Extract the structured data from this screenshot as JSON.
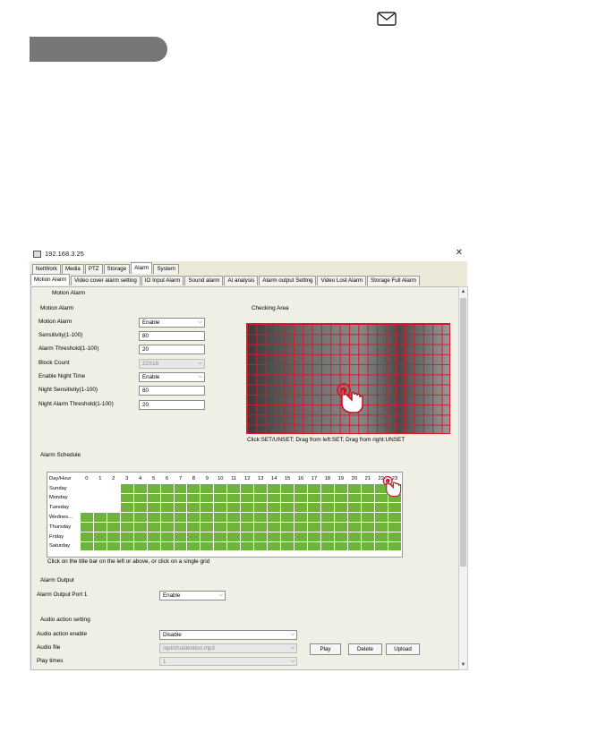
{
  "window": {
    "title": "192.168.3.25",
    "close_glyph": "✕"
  },
  "main_tabs": [
    "NetWork",
    "Media",
    "PTZ",
    "Storage",
    "Alarm",
    "System"
  ],
  "sub_tabs": [
    "Motion Alarm",
    "Video cover alarm setting",
    "IO Input Alarm",
    "Sound alarm",
    "AI analysis",
    "Alarm output Setting",
    "Video Lost Alarm",
    "Storage Full Alarm"
  ],
  "page": {
    "title": "Motion Alarm"
  },
  "motion": {
    "section": "Motion Alarm",
    "motion_alarm_label": "Motion Alarm",
    "motion_alarm_value": "Enable",
    "sensitivity_label": "Sensitivity(1-100)",
    "sensitivity_value": "80",
    "threshold_label": "Alarm Threshold(1-100)",
    "threshold_value": "20",
    "block_count_label": "Block Count",
    "block_count_value": "22X18",
    "night_time_label": "Enable Night Time",
    "night_time_value": "Enable",
    "night_sens_label": "Night Sensitivity(1-100)",
    "night_sens_value": "80",
    "night_threshold_label": "Night Alarm Threshold(1-100)",
    "night_threshold_value": "20"
  },
  "checking": {
    "title": "Checking Area",
    "hint": "Click:SET/UNSET; Drag from left:SET; Drag from right:UNSET"
  },
  "schedule": {
    "title": "Alarm Schedule",
    "header": "Day/Hour",
    "hours": [
      "0",
      "1",
      "2",
      "3",
      "4",
      "5",
      "6",
      "7",
      "8",
      "9",
      "10",
      "11",
      "12",
      "13",
      "14",
      "15",
      "16",
      "17",
      "18",
      "19",
      "20",
      "21",
      "22",
      "23"
    ],
    "days": [
      "Sunday",
      "Monday",
      "Tuesday",
      "Wednes...",
      "Thursday",
      "Friday",
      "Saturday"
    ],
    "first_active_hour": [
      3,
      3,
      3,
      0,
      0,
      0,
      0
    ],
    "hint": "Click on the title bar on the left or above, or click on a single grid"
  },
  "alarm_output": {
    "title": "Alarm Output",
    "port_label": "Alarm Output Port 1",
    "port_value": "Enable"
  },
  "audio": {
    "title": "Audio action setting",
    "enable_label": "Audio action enable",
    "enable_value": "Disable",
    "file_label": "Audio file",
    "file_value": "/opt/ch/attention.mp3",
    "times_label": "Play times",
    "times_value": "1",
    "play_btn": "Play",
    "delete_btn": "Delete",
    "upload_btn": "Upload"
  },
  "colors": {
    "grid_red": "#d7192c",
    "schedule_green": "#6eb43b",
    "header_gray": "#767676"
  },
  "icons": [
    "mail-icon",
    "hand-pointer-icon",
    "chevron-down-icon"
  ]
}
